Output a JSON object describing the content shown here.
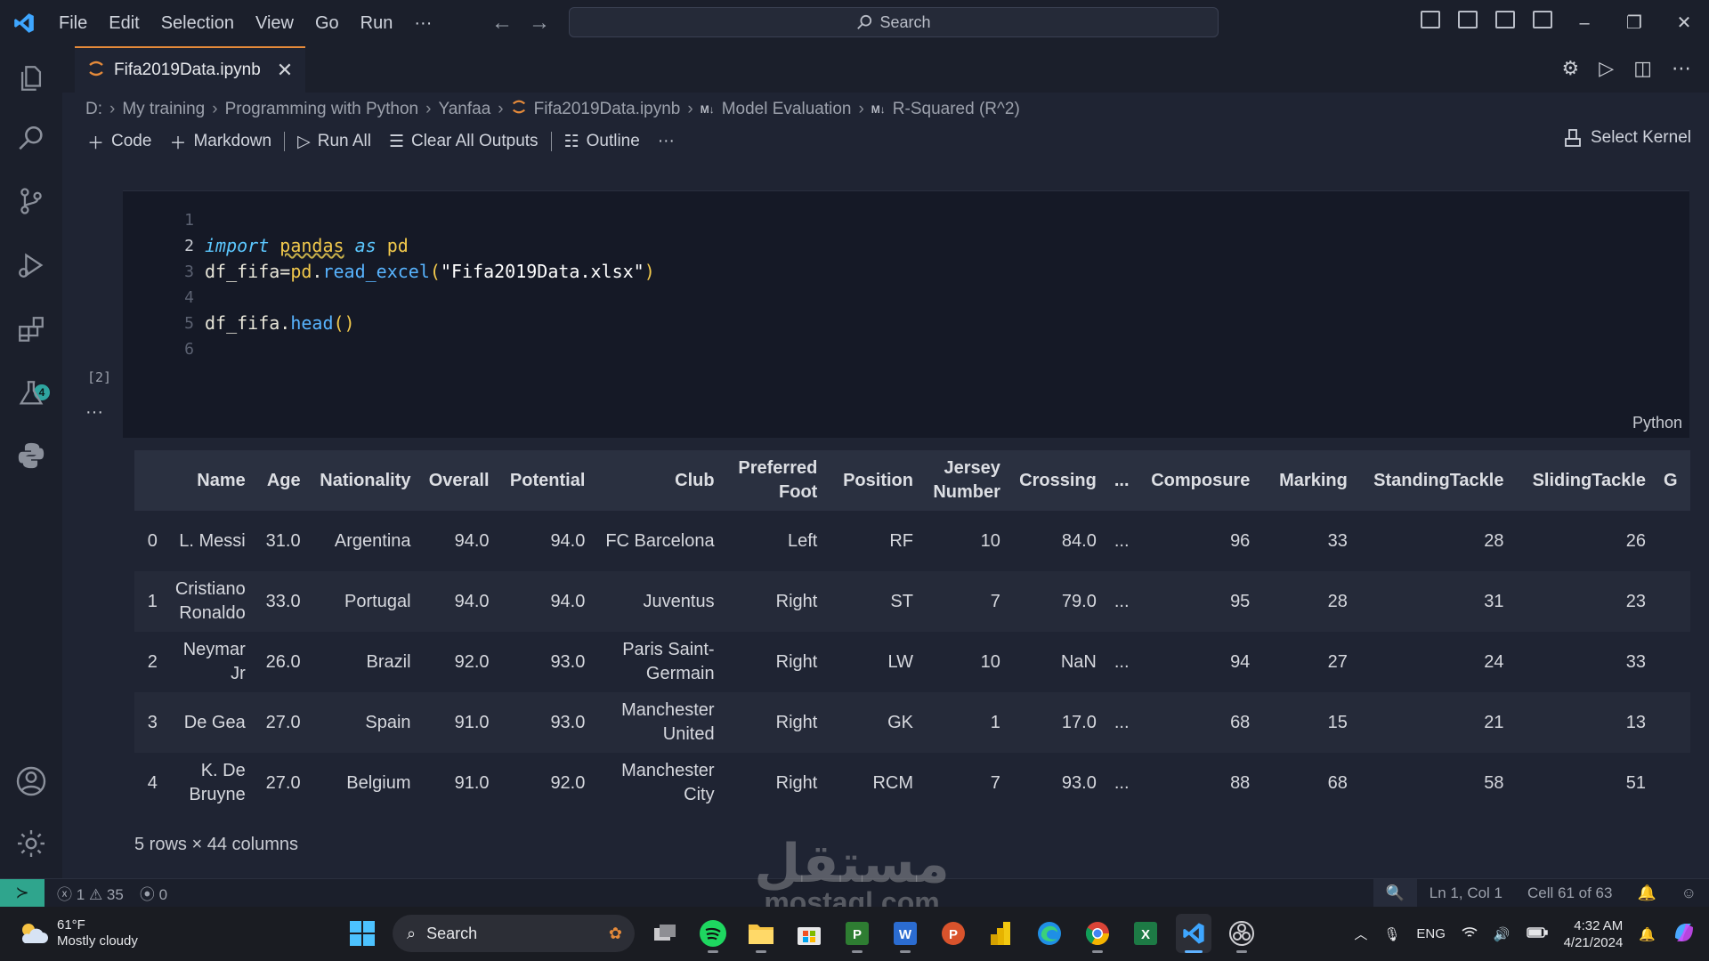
{
  "titlebar": {
    "menu": [
      "File",
      "Edit",
      "Selection",
      "View",
      "Go",
      "Run",
      "···"
    ],
    "search_placeholder": "Search"
  },
  "activity_bar": {
    "extensions_badge": "4"
  },
  "tab": {
    "title": "Fifa2019Data.ipynb"
  },
  "breadcrumb": {
    "items": [
      "D:",
      "My training",
      "Programming with Python",
      "Yanfaa",
      "Fifa2019Data.ipynb",
      "Model Evaluation",
      "R-Squared  (R^2)"
    ],
    "md_tag": "M↓"
  },
  "notebook_toolbar": {
    "code": "Code",
    "markdown": "Markdown",
    "run_all": "Run All",
    "clear_all_outputs": "Clear All Outputs",
    "outline": "Outline",
    "more": "···",
    "select_kernel": "Select Kernel"
  },
  "code_cell": {
    "line_numbers": [
      "1",
      "2",
      "3",
      "4",
      "5",
      "6"
    ],
    "language": "Python",
    "execution_count": "[2]",
    "output_more": "···"
  },
  "output_table": {
    "columns": [
      "",
      "Name",
      "Age",
      "Nationality",
      "Overall",
      "Potential",
      "Club",
      "Preferred Foot",
      "Position",
      "Jersey Number",
      "Crossing",
      "...",
      "Composure",
      "Marking",
      "StandingTackle",
      "SlidingTackle",
      "G"
    ],
    "rows": [
      [
        "0",
        "L. Messi",
        "31.0",
        "Argentina",
        "94.0",
        "94.0",
        "FC Barcelona",
        "Left",
        "RF",
        "10",
        "84.0",
        "...",
        "96",
        "33",
        "28",
        "26",
        ""
      ],
      [
        "1",
        "Cristiano Ronaldo",
        "33.0",
        "Portugal",
        "94.0",
        "94.0",
        "Juventus",
        "Right",
        "ST",
        "7",
        "79.0",
        "...",
        "95",
        "28",
        "31",
        "23",
        ""
      ],
      [
        "2",
        "Neymar Jr",
        "26.0",
        "Brazil",
        "92.0",
        "93.0",
        "Paris Saint-Germain",
        "Right",
        "LW",
        "10",
        "NaN",
        "...",
        "94",
        "27",
        "24",
        "33",
        ""
      ],
      [
        "3",
        "De Gea",
        "27.0",
        "Spain",
        "91.0",
        "93.0",
        "Manchester United",
        "Right",
        "GK",
        "1",
        "17.0",
        "...",
        "68",
        "15",
        "21",
        "13",
        ""
      ],
      [
        "4",
        "K. De Bruyne",
        "27.0",
        "Belgium",
        "91.0",
        "92.0",
        "Manchester City",
        "Right",
        "RCM",
        "7",
        "93.0",
        "...",
        "88",
        "68",
        "58",
        "51",
        ""
      ]
    ],
    "summary": "5 rows × 44 columns"
  },
  "statusbar": {
    "errors": "1",
    "warnings": "35",
    "ports": "0",
    "cursor": "Ln 1, Col 1",
    "cell": "Cell 61 of 63"
  },
  "taskbar": {
    "temperature": "61°F",
    "weather": "Mostly cloudy",
    "search": "Search",
    "language": "ENG",
    "time": "4:32 AM",
    "date": "4/21/2024"
  },
  "watermark": {
    "arabic": "مستقل",
    "latin": "mostaql.com"
  },
  "colors": {
    "accent_orange": "#e58a3a",
    "status_teal": "#2fa58d",
    "keyword_blue": "#5cc8ff",
    "module_yellow": "#f2c94c"
  }
}
